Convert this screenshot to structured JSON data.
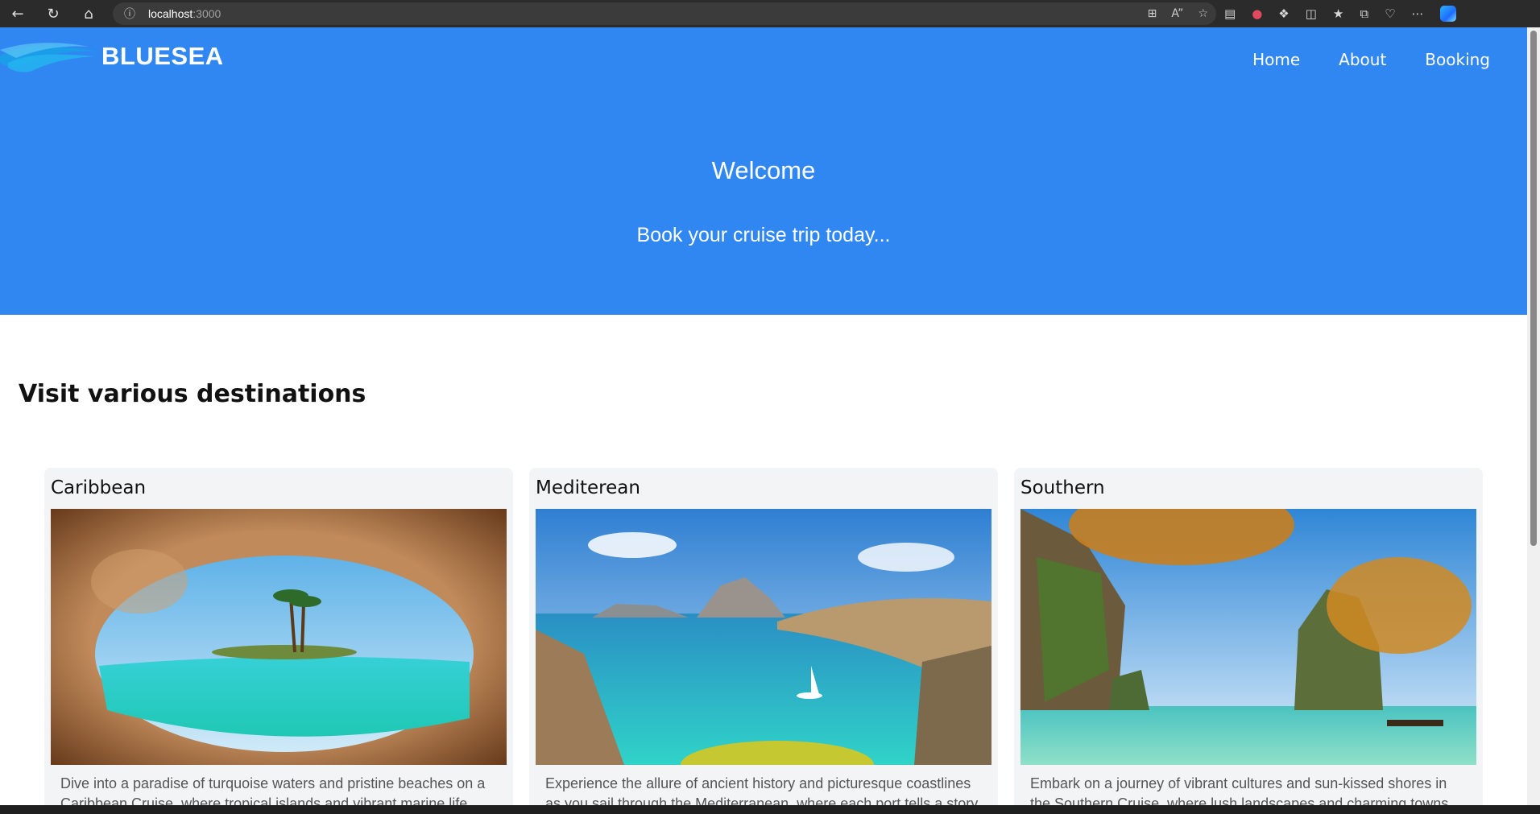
{
  "browser": {
    "url_host": "localhost",
    "url_port": ":3000"
  },
  "header": {
    "logo_text": "BLUESEA",
    "nav": [
      {
        "label": "Home"
      },
      {
        "label": "About"
      },
      {
        "label": "Booking"
      }
    ],
    "welcome": "Welcome",
    "tagline": "Book your cruise trip today..."
  },
  "destinations": {
    "title": "Visit various destinations",
    "cards": [
      {
        "title": "Caribbean",
        "image": "caribbean-cave-island-image",
        "description": "Dive into a paradise of turquoise waters and pristine beaches on a Caribbean Cruise, where tropical islands and vibrant marine life"
      },
      {
        "title": "Mediterean",
        "image": "mediterranean-bay-image",
        "description": "Experience the allure of ancient history and picturesque coastlines as you sail through the Mediterranean, where each port tells a story"
      },
      {
        "title": "Southern",
        "image": "southern-limestone-islands-image",
        "description": "Embark on a journey of vibrant cultures and sun-kissed shores in the Southern Cruise, where lush landscapes and charming towns"
      }
    ]
  },
  "colors": {
    "hero": "#3087f2",
    "card_bg": "#f3f4f6"
  }
}
